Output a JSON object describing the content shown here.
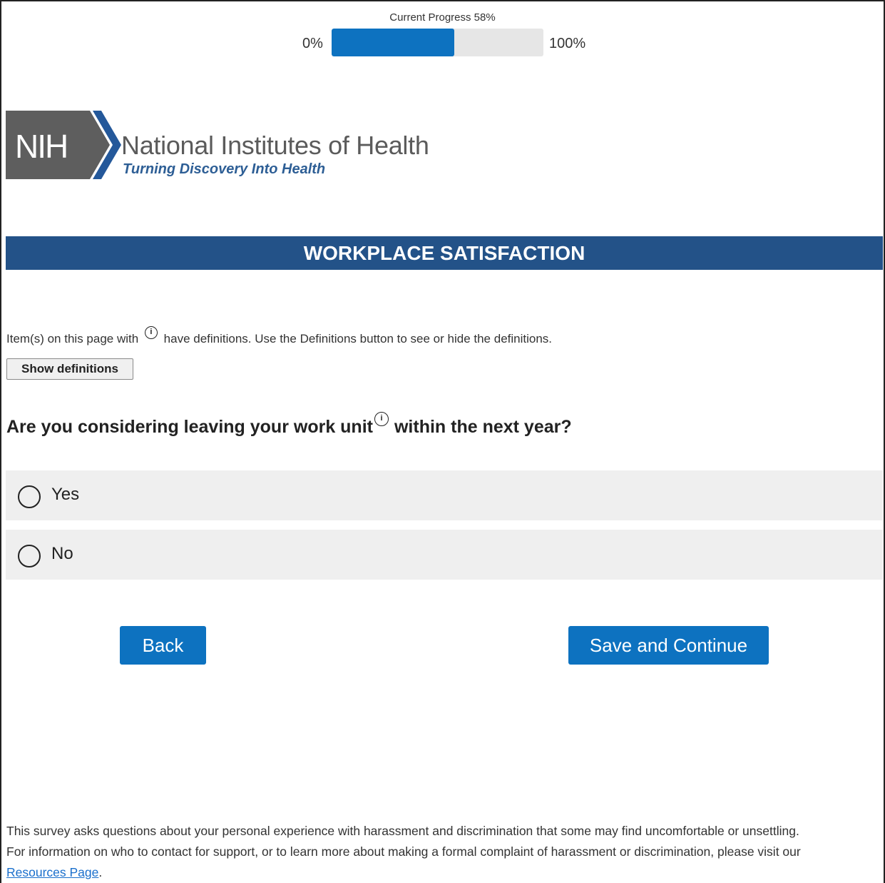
{
  "progress": {
    "label": "Current Progress 58%",
    "value": 0.58,
    "min_label": "0%",
    "max_label": "100%",
    "fill_color": "#0d72c0"
  },
  "logo": {
    "mark": "NIH",
    "name": "National Institutes of Health",
    "tagline": "Turning Discovery Into Health"
  },
  "section_title": "WORKPLACE SATISFACTION",
  "definitions": {
    "note_before": "Item(s) on this page with",
    "note_after": "have definitions. Use the Definitions button to see or hide the definitions.",
    "button_label": "Show definitions",
    "icon": "info-icon"
  },
  "question": {
    "text_before": "Are you considering leaving your work unit",
    "text_after": "within the next year?",
    "options": [
      {
        "label": "Yes",
        "selected": false
      },
      {
        "label": "No",
        "selected": false
      }
    ]
  },
  "nav": {
    "back_label": "Back",
    "save_label": "Save and Continue"
  },
  "footer": {
    "line1": "This survey asks questions about your personal experience with harassment and discrimination that some may find uncomfortable or unsettling.",
    "line2": "For information on who to contact for support, or to learn more about making a formal complaint of harassment or discrimination, please visit our",
    "link_text": "Resources Page",
    "trailing": "."
  },
  "colors": {
    "banner": "#235288",
    "button": "#0d72c0",
    "option_bg": "#efefef"
  }
}
